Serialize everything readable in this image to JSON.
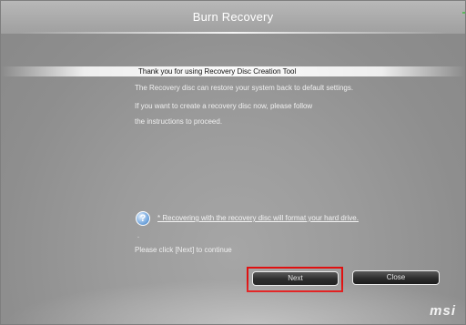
{
  "window": {
    "title": "Burn Recovery"
  },
  "content": {
    "heading": "Thank you for using Recovery Disc Creation Tool",
    "lines": [
      "The Recovery disc can restore your system back to default settings.",
      "If you want to create a recovery disc now, please follow",
      "the instructions to proceed."
    ],
    "warning": "* Recovering with the recovery disc will format your hard drive.",
    "dash": "-",
    "continue_text": "Please click [Next] to continue"
  },
  "buttons": {
    "next": "Next",
    "close": "Close"
  },
  "logo": {
    "text": "msi"
  },
  "icons": {
    "info": "info-icon"
  },
  "colors": {
    "highlight": "#e01010"
  }
}
